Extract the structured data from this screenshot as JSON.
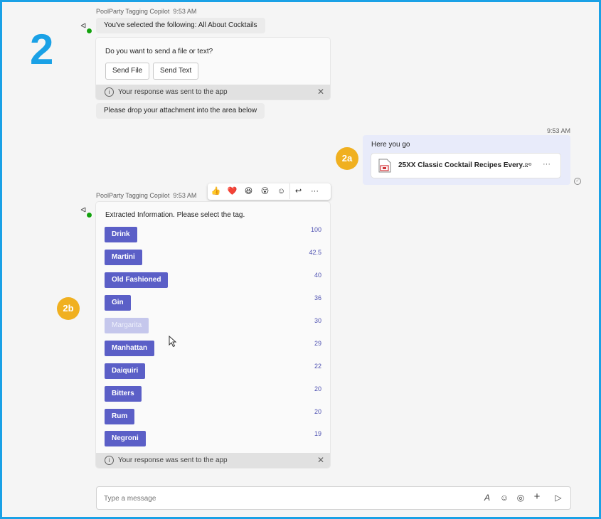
{
  "step_label": "2",
  "badges": {
    "a": "2a",
    "b": "2b"
  },
  "message1": {
    "sender": "PoolParty Tagging Copilot",
    "time": "9:53 AM",
    "selected_text": "You've selected the following: All About Cocktails",
    "question": "Do you want to send a file or text?",
    "send_file_label": "Send File",
    "send_text_label": "Send Text",
    "response_text": "Your response was sent to the app",
    "drop_text": "Please drop your attachment into the area below"
  },
  "user_message": {
    "time": "9:53 AM",
    "text": "Here you go",
    "file_name": "25XX Classic Cocktail Recipes Every..."
  },
  "reactions": {
    "thumbs": "👍",
    "heart": "❤️",
    "laugh": "😆",
    "surprised": "😮",
    "add_reaction": "☺",
    "reply": "↩",
    "more": "···"
  },
  "message2": {
    "sender": "PoolParty Tagging Copilot",
    "time": "9:53 AM",
    "title": "Extracted Information. Please select the tag.",
    "tags": [
      {
        "label": "Drink",
        "score": "100"
      },
      {
        "label": "Martini",
        "score": "42.5"
      },
      {
        "label": "Old Fashioned",
        "score": "40"
      },
      {
        "label": "Gin",
        "score": "36"
      },
      {
        "label": "Margarita",
        "score": "30"
      },
      {
        "label": "Manhattan",
        "score": "29"
      },
      {
        "label": "Daiquiri",
        "score": "22"
      },
      {
        "label": "Bitters",
        "score": "20"
      },
      {
        "label": "Rum",
        "score": "20"
      },
      {
        "label": "Negroni",
        "score": "19"
      }
    ],
    "response_text": "Your response was sent to the app"
  },
  "composer": {
    "placeholder": "Type a message"
  },
  "colors": {
    "frame": "#1aa1e6",
    "tag": "#5b5fc7",
    "badge": "#f0b020",
    "status": "#13a10e"
  }
}
